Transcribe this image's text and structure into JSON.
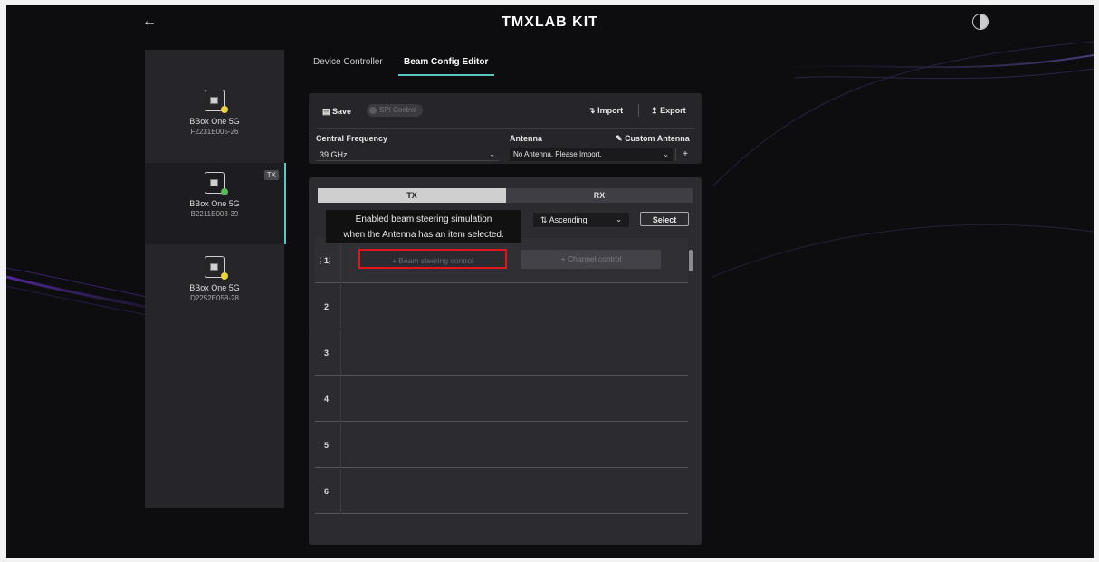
{
  "header": {
    "brand": "TMXLAB KIT",
    "back_icon": "arrow-left-icon",
    "avatar_icon": "half-circle-icon"
  },
  "devices": [
    {
      "name": "BBox One 5G",
      "serial": "F2231E005-26",
      "status_color": "#e8d43a",
      "badge": ""
    },
    {
      "name": "BBox One 5G",
      "serial": "B2211E003-39",
      "status_color": "#58b85a",
      "badge": "TX"
    },
    {
      "name": "BBox One 5G",
      "serial": "D2252E058-28",
      "status_color": "#e8d43a",
      "badge": ""
    }
  ],
  "tabs": [
    {
      "label": "Device Controller"
    },
    {
      "label": "Beam Config Editor",
      "active": true
    }
  ],
  "toolbar": {
    "save_label": "Save",
    "spi_label": "SPI Control",
    "import_label": "Import",
    "export_label": "Export"
  },
  "config": {
    "central_frequency_label": "Central Frequency",
    "central_frequency_value": "39 GHz",
    "antenna_label": "Antenna",
    "antenna_value": "No Antenna. Please Import.",
    "custom_antenna_label": "Custom Antenna",
    "add_label": "+"
  },
  "beam": {
    "tab_tx": "TX",
    "tab_rx": "RX",
    "sort_value": "Ascending",
    "select_label": "Select",
    "tooltip_line1": "Enabled beam steering simulation",
    "tooltip_line2": "when the Antenna has an item selected.",
    "rows": [
      "1",
      "2",
      "3",
      "4",
      "5",
      "6"
    ],
    "beam_steering_label": "+ Beam steering control",
    "channel_control_label": "+ Channel control"
  },
  "colors": {
    "accent": "#58c8c0",
    "highlight": "#e0161c"
  }
}
